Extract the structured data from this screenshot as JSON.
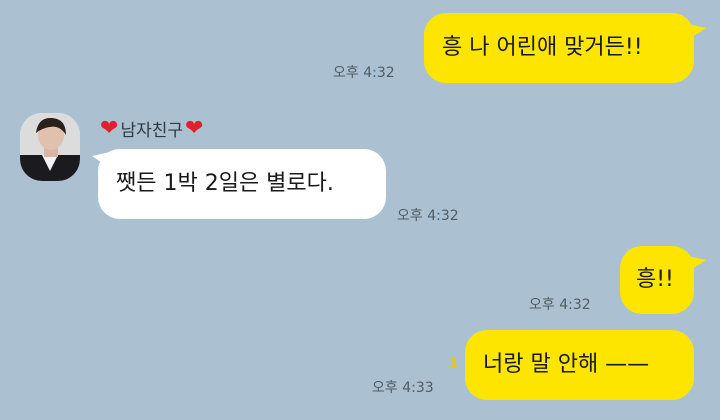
{
  "messages": [
    {
      "from": "me",
      "text": "흥 나 어린애 맞거든!!",
      "time": "오후 4:32"
    },
    {
      "from": "friend",
      "sender": "남자친구",
      "text": "쨋든 1박 2일은 별로다.",
      "time": "오후 4:32"
    },
    {
      "from": "me",
      "text": "흥!!",
      "time": "오후 4:32"
    },
    {
      "from": "me",
      "text": "너랑 말 안해 ——",
      "time": "오후 4:33",
      "unread": "1"
    }
  ],
  "icons": {
    "heart": "heart-icon",
    "avatar": "profile-avatar"
  },
  "colors": {
    "background": "#abc1d1",
    "my_bubble": "#fee500",
    "friend_bubble": "#ffffff",
    "unread": "#f2c500"
  }
}
